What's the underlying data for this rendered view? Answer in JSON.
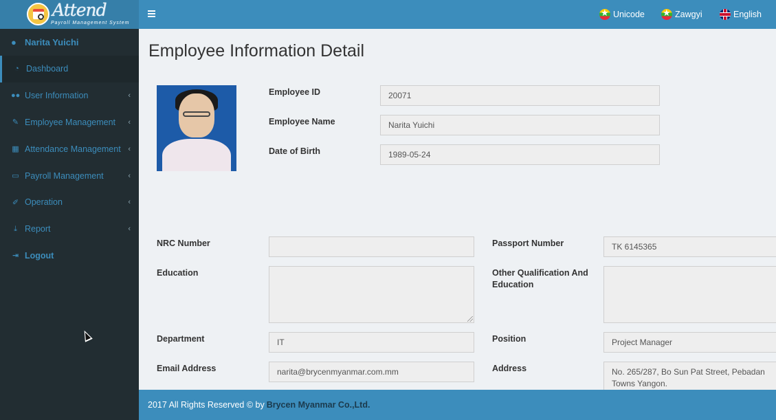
{
  "app": {
    "logo_title": "Attend",
    "logo_subtitle": "Payroll Management System"
  },
  "sidebar": {
    "user_name": "Narita Yuichi",
    "items": [
      {
        "label": "Dashboard",
        "icon": "dashboard-icon"
      },
      {
        "label": "User Information",
        "icon": "users-icon"
      },
      {
        "label": "Employee Management",
        "icon": "edit-icon"
      },
      {
        "label": "Attendance Management",
        "icon": "grid-icon"
      },
      {
        "label": "Payroll Management",
        "icon": "laptop-icon"
      },
      {
        "label": "Operation",
        "icon": "pencil-square-icon"
      },
      {
        "label": "Report",
        "icon": "download-icon"
      },
      {
        "label": "Logout",
        "icon": "sign-out-icon"
      }
    ]
  },
  "header": {
    "languages": [
      "Unicode",
      "Zawgyi",
      "English"
    ]
  },
  "page": {
    "title": "Employee Information Detail"
  },
  "employee": {
    "id_label": "Employee ID",
    "id": "20071",
    "name_label": "Employee Name",
    "name": "Narita Yuichi",
    "dob_label": "Date of Birth",
    "dob": "1989-05-24",
    "nrc_label": "NRC Number",
    "nrc": "",
    "passport_label": "Passport Number",
    "passport": "TK 6145365",
    "education_label": "Education",
    "education": "",
    "other_qual_label": "Other Qualification And Education",
    "other_qual": "",
    "department_label": "Department",
    "department": "IT",
    "position_label": "Position",
    "position": "Project Manager",
    "email_label": "Email Address",
    "email": "narita@brycenmyanmar.com.mm",
    "address_label": "Address",
    "address": "No. 265/287, Bo Sun Pat Street, Pebadan Towns Yangon."
  },
  "footer": {
    "text": "2017 All Rights Reserved © by",
    "company": "Brycen Myanmar Co.,Ltd."
  },
  "colors": {
    "header": "#3c8dbc",
    "sidebar": "#222d32",
    "accent": "#3c8dbc"
  }
}
